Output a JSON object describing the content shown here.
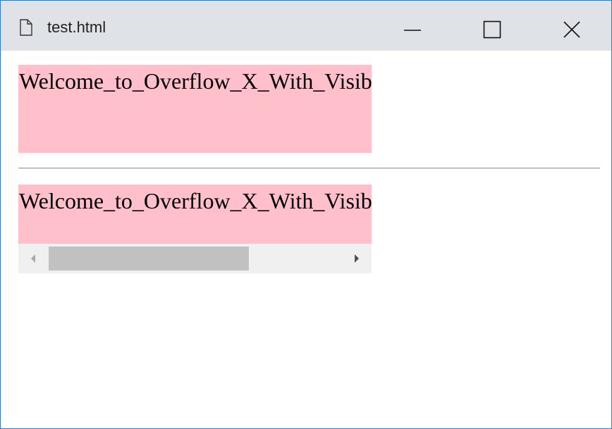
{
  "window": {
    "title": "test.html",
    "file_icon": "document-icon",
    "controls": {
      "minimize_icon": "minimize-icon",
      "maximize_icon": "maximize-icon",
      "close_icon": "close-icon"
    },
    "frame_color": "#2b7bd2",
    "titlebar_color": "#dfe3e8"
  },
  "content": {
    "box_hidden": {
      "text": "Welcome_to_Overflow_X_With_Visible_Text",
      "background": "#ffc0cb"
    },
    "box_scroll": {
      "text": "Welcome_to_Overflow_X_With_Visible_Text",
      "background": "#ffc0cb",
      "scroll_position_fraction": 0
    },
    "scrollbar": {
      "left_arrow_icon": "scroll-left-arrow-icon",
      "right_arrow_icon": "scroll-right-arrow-icon"
    }
  }
}
